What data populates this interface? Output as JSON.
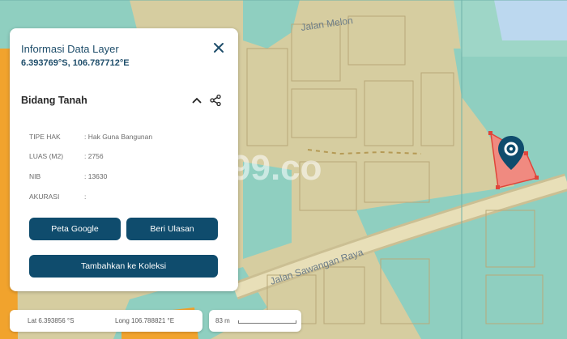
{
  "panel": {
    "title": "Informasi Data Layer",
    "coordinates": "6.393769°S, 106.787712°E",
    "section_title": "Bidang Tanah",
    "rows": [
      {
        "key": "TIPE HAK",
        "value": ": Hak Guna Bangunan"
      },
      {
        "key": "LUAS (M2)",
        "value": ": 2756"
      },
      {
        "key": "NIB",
        "value": ": 13630"
      },
      {
        "key": "AKURASI",
        "value": ":"
      }
    ],
    "buttons": {
      "google": "Peta Google",
      "review": "Beri Ulasan",
      "collection": "Tambahkan ke Koleksi"
    }
  },
  "status": {
    "lat": "Lat 6.393856 °S",
    "long": "Long 106.788821 °E"
  },
  "scale": {
    "label": "83 m"
  },
  "map": {
    "street_melon": "Jalan Melon",
    "street_sawangan": "Jalan Sawangan Raya",
    "watermark": "99.co",
    "icons": [
      "location-pin-icon"
    ],
    "colors": {
      "land": "#d9d0a3",
      "parcel_teal": "#8ccfc0",
      "highlight": "#f08a80",
      "orange": "#f1a32d",
      "water": "#bcd8ef"
    }
  }
}
